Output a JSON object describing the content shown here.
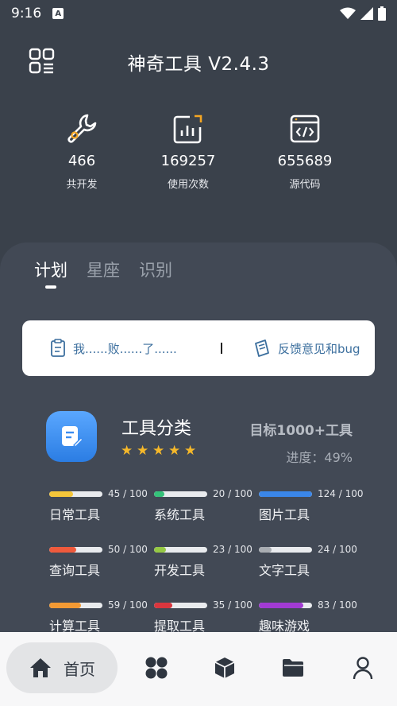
{
  "status": {
    "time": "9:16"
  },
  "header": {
    "title": "神奇工具 V2.4.3"
  },
  "stats": [
    {
      "value": "466",
      "label": "共开发",
      "icon": "wrench-icon"
    },
    {
      "value": "169257",
      "label": "使用次数",
      "icon": "chart-icon"
    },
    {
      "value": "655689",
      "label": "源代码",
      "icon": "code-icon"
    }
  ],
  "tabs": [
    "计划",
    "星座",
    "识别"
  ],
  "notice": {
    "left": "我......败......了......",
    "right": "反馈意见和bug"
  },
  "category": {
    "title": "工具分类",
    "goal": "目标1000+工具",
    "progress": "进度：49%",
    "stars": 5
  },
  "tools": [
    {
      "name": "日常工具",
      "count": "45 / 100",
      "ratio": 0.45,
      "color": "#f5c63a"
    },
    {
      "name": "系统工具",
      "count": "20 / 100",
      "ratio": 0.2,
      "color": "#35c27a"
    },
    {
      "name": "图片工具",
      "count": "124 / 100",
      "ratio": 1.0,
      "color": "#3a86e8"
    },
    {
      "name": "查询工具",
      "count": "50 / 100",
      "ratio": 0.5,
      "color": "#ef5a3c"
    },
    {
      "name": "开发工具",
      "count": "23 / 100",
      "ratio": 0.23,
      "color": "#95c844"
    },
    {
      "name": "文字工具",
      "count": "24 / 100",
      "ratio": 0.24,
      "color": "#a9adb2"
    },
    {
      "name": "计算工具",
      "count": "59 / 100",
      "ratio": 0.59,
      "color": "#f39a34"
    },
    {
      "name": "提取工具",
      "count": "35 / 100",
      "ratio": 0.35,
      "color": "#d9363e"
    },
    {
      "name": "趣味游戏",
      "count": "83 / 100",
      "ratio": 0.83,
      "color": "#a23bd3"
    }
  ],
  "nav": {
    "home_label": "首页"
  }
}
